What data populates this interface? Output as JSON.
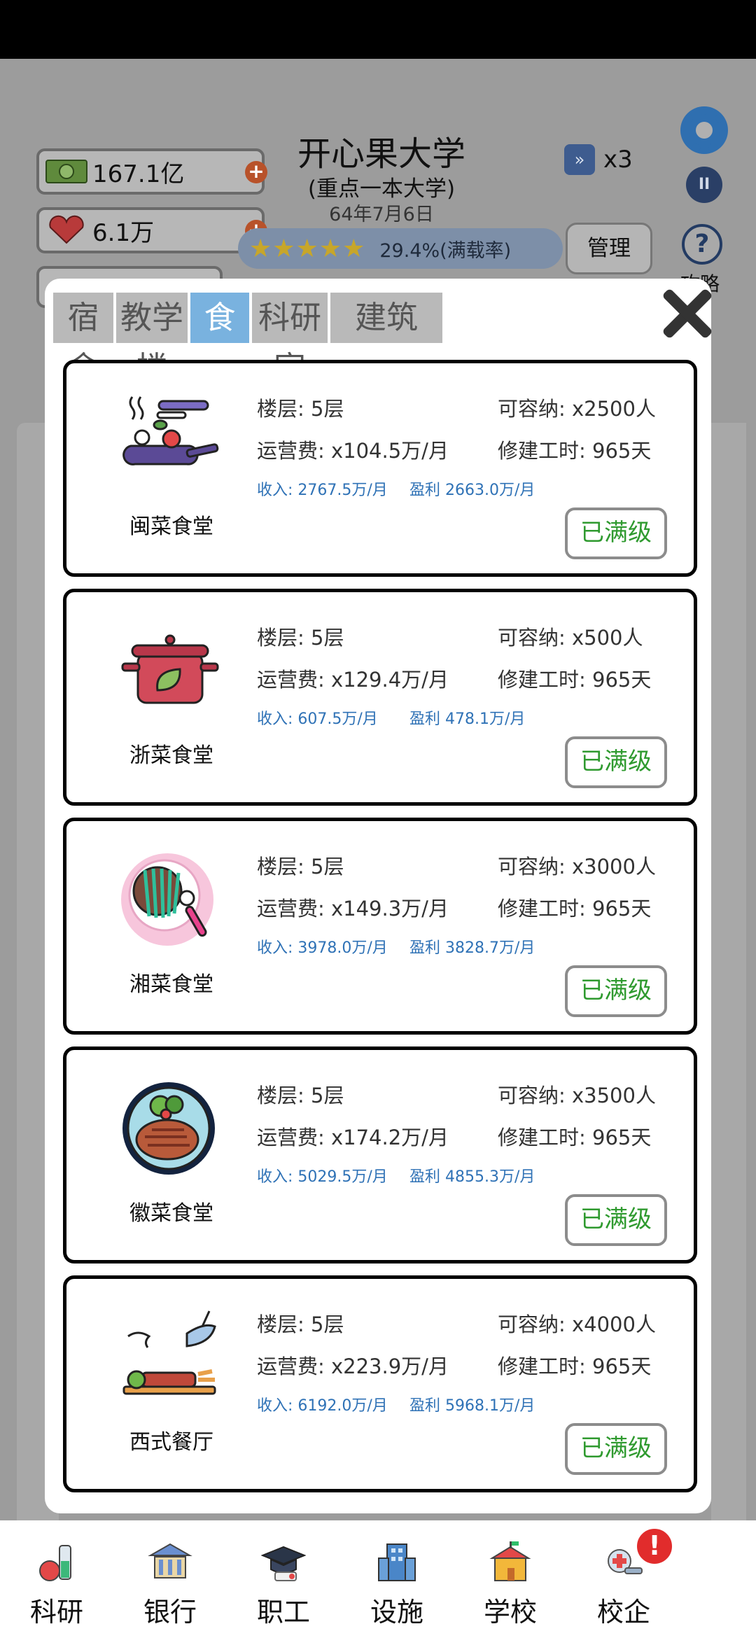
{
  "header": {
    "money": "167.1亿",
    "hearts": "6.1万",
    "school_name": "开心果大学",
    "school_type": "(重点一本大学)",
    "date": "64年7月6日",
    "speed": "x3",
    "rating_text": "29.4%(满载率)",
    "rating_stars": "★★★★★",
    "manage_label": "管理",
    "help_label": "攻略"
  },
  "modal": {
    "tabs": [
      {
        "label": "宿舍",
        "active": false
      },
      {
        "label": "教学楼",
        "active": false
      },
      {
        "label": "食堂",
        "active": true
      },
      {
        "label": "科研室",
        "active": false
      },
      {
        "label": "建筑",
        "active": false
      }
    ],
    "cards": [
      {
        "name": "闽菜食堂",
        "floors": "楼层: 5层",
        "capacity": "可容纳: x2500人",
        "cost": "运营费: x104.5万/月",
        "build": "修建工时: 965天",
        "income": "收入: 2767.5万/月",
        "profit": "盈利 2663.0万/月",
        "button": "已满级",
        "icon": "cooking-pan-icon"
      },
      {
        "name": "浙菜食堂",
        "floors": "楼层: 5层",
        "capacity": "可容纳: x500人",
        "cost": "运营费: x129.4万/月",
        "build": "修建工时: 965天",
        "income": "收入: 607.5万/月",
        "profit": "盈利 478.1万/月",
        "button": "已满级",
        "icon": "soup-pot-icon"
      },
      {
        "name": "湘菜食堂",
        "floors": "楼层: 5层",
        "capacity": "可容纳: x3000人",
        "cost": "运营费: x149.3万/月",
        "build": "修建工时: 965天",
        "income": "收入: 3978.0万/月",
        "profit": "盈利 3828.7万/月",
        "button": "已满级",
        "icon": "noodle-plate-icon"
      },
      {
        "name": "徽菜食堂",
        "floors": "楼层: 5层",
        "capacity": "可容纳: x3500人",
        "cost": "运营费: x174.2万/月",
        "build": "修建工时: 965天",
        "income": "收入: 5029.5万/月",
        "profit": "盈利 4855.3万/月",
        "button": "已满级",
        "icon": "steak-plate-icon"
      },
      {
        "name": "西式餐厅",
        "floors": "楼层: 5层",
        "capacity": "可容纳: x4000人",
        "cost": "运营费: x223.9万/月",
        "build": "修建工时: 965天",
        "income": "收入: 6192.0万/月",
        "profit": "盈利 5968.1万/月",
        "button": "已满级",
        "icon": "western-dish-icon"
      }
    ]
  },
  "bottom_nav": [
    {
      "label": "科研",
      "icon": "lab-flask-icon"
    },
    {
      "label": "银行",
      "icon": "bank-icon"
    },
    {
      "label": "职工",
      "icon": "graduation-cap-icon"
    },
    {
      "label": "设施",
      "icon": "building-icon"
    },
    {
      "label": "学校",
      "icon": "school-icon"
    },
    {
      "label": "校企",
      "icon": "enterprise-icon",
      "badge": "!"
    }
  ],
  "colors": {
    "active_tab": "#79b2df",
    "level_button_text": "#2f9a2f",
    "income_text": "#2f72b6"
  }
}
